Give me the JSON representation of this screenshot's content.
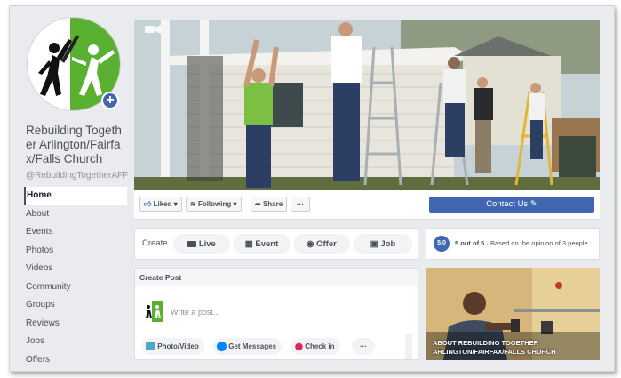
{
  "page": {
    "name": "Rebuilding Together Arlington/Fairfax/Falls Church",
    "handle": "@RebuildingTogetherAFF"
  },
  "sidebar": {
    "items": [
      {
        "label": "Home",
        "active": true
      },
      {
        "label": "About"
      },
      {
        "label": "Events"
      },
      {
        "label": "Photos"
      },
      {
        "label": "Videos"
      },
      {
        "label": "Community"
      },
      {
        "label": "Groups"
      },
      {
        "label": "Reviews"
      },
      {
        "label": "Jobs"
      },
      {
        "label": "Offers"
      }
    ]
  },
  "actions": {
    "liked": "Liked",
    "following": "Following",
    "share": "Share",
    "more": "···",
    "contact": "Contact Us"
  },
  "create": {
    "label": "Create",
    "live": "Live",
    "event": "Event",
    "offer": "Offer",
    "job": "Job"
  },
  "rating": {
    "score": "5.0",
    "bold": "5 out of 5",
    "rest": " · Based on the opinion of 3 people"
  },
  "post": {
    "header": "Create Post",
    "placeholder": "Write a post...",
    "photo_video": "Photo/Video",
    "get_messages": "Get Messages",
    "check_in": "Check in",
    "more": "···"
  },
  "about_card": {
    "caption": "ABOUT REBUILDING TOGETHER ARLINGTON/FAIRFAX/FALLS CHURCH"
  },
  "colors": {
    "brand_blue": "#4267b2",
    "logo_green": "#5ab031",
    "page_bg": "#e9ebee"
  },
  "icons": [
    "plus-icon",
    "like-icon",
    "rss-icon",
    "share-icon",
    "pencil-icon",
    "video-icon",
    "calendar-icon",
    "offer-icon",
    "briefcase-icon",
    "photo-icon",
    "messenger-icon",
    "pin-icon"
  ]
}
